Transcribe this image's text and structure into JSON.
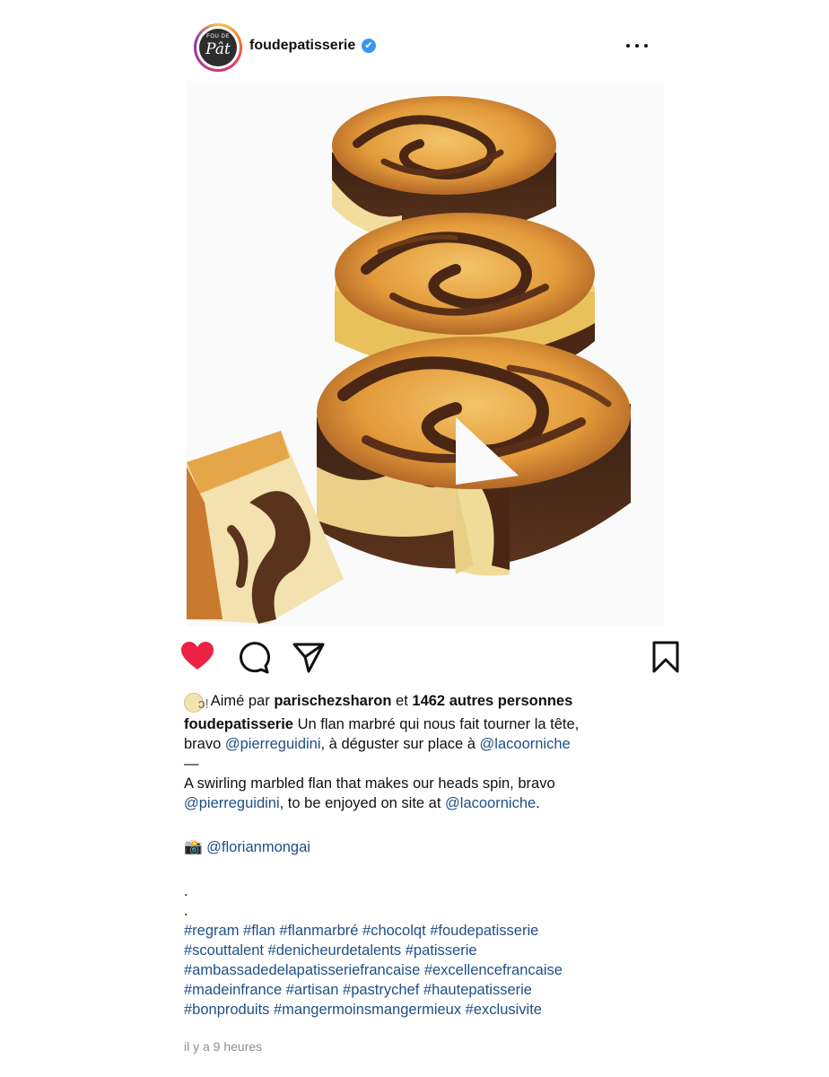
{
  "post": {
    "username": "foudepatisserie",
    "avatar": {
      "line1": "FOU DE",
      "line2": "Pât"
    },
    "verified_icon": "✔",
    "more_icon": "more-horizontal-icon"
  },
  "actions": {
    "like_icon": "heart-filled-icon",
    "comment_icon": "comment-icon",
    "share_icon": "send-icon",
    "save_icon": "bookmark-icon",
    "like_color": "#ed2045"
  },
  "likes": {
    "prefix": "Aimé par",
    "liker": "parischezsharon",
    "connector": "et",
    "others": "1462 autres personnes"
  },
  "caption": {
    "author": "foudepatisserie",
    "line1": "Un flan marbré qui nous fait tourner la tête,",
    "bravo": "bravo",
    "mention1": "@pierreguidini",
    "mid1": ", à déguster sur place à",
    "mention2": "@lacoorniche",
    "dash": "—",
    "en_line1": "A swirling marbled flan that makes our heads spin, bravo",
    "en_mention1": "@pierreguidini",
    "en_mid": ", to be enjoyed on site at",
    "en_mention2": "@lacoorniche",
    "en_end": ".",
    "camera": "📸",
    "photo_credit": "@florianmongai",
    "dot1": ".",
    "dot2": ".",
    "hashtags_line1": "#regram #flan #flanmarbré #chocolqt #foudepatisserie",
    "hashtags_line2": "#scouttalent #denicheurdetalents #patisserie",
    "hashtags_line3": "#ambassadedelapatisseriefrancaise #excellencefrancaise",
    "hashtags_line4": "#madeinfrance #artisan #pastrychef #hautepatisserie",
    "hashtags_line5": "#bonproduits #mangermoinsmangermieux #exclusivite"
  },
  "timestamp": "il y a 9 heures"
}
